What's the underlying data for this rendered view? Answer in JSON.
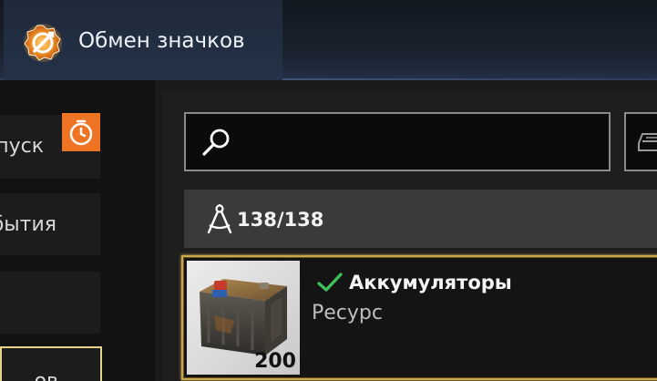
{
  "header": {
    "tab_title": "Обмен значков",
    "tab_icon": "badge-exchange-icon",
    "accent": "#f08a2a"
  },
  "sidebar": {
    "items": [
      {
        "label": "пуск",
        "badge_icon": "timer-icon",
        "badge_color": "#ee7322"
      },
      {
        "label": "бытия"
      },
      {
        "label": ""
      },
      {
        "label": "ов",
        "selected": true
      }
    ]
  },
  "search": {
    "value": "",
    "placeholder": "",
    "icon": "search-icon",
    "filter_icon": "vehicle-filter-icon"
  },
  "counter": {
    "icon": "drafting-compass-icon",
    "text": "138/138"
  },
  "items": [
    {
      "name": "Аккумуляторы",
      "type": "Ресурс",
      "quantity": "200",
      "owned_icon": "checkmark-icon",
      "check_color": "#3ec05a",
      "border_color": "#c9a74a",
      "image": "battery-icon"
    }
  ]
}
